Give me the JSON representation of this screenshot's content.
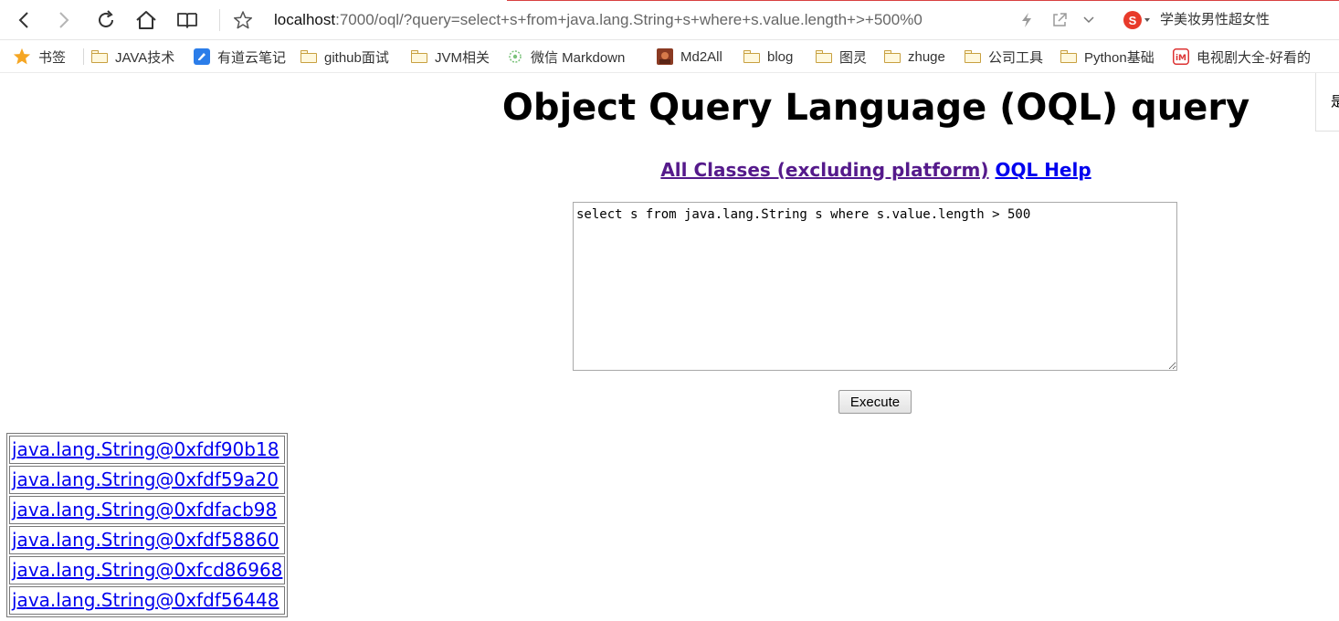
{
  "browser": {
    "url_host": "localhost",
    "url_rest": ":7000/oql/?query=select+s+from+java.lang.String+s+where+s.value.length+>+500%0",
    "search_hint": "学美妆男性超女性",
    "search_engine_glyph": "S",
    "side_tab_text": "是",
    "icons": [
      "back-icon",
      "forward-icon",
      "reload-icon",
      "home-icon",
      "reader-icon",
      "star-icon",
      "lightning-icon",
      "share-icon",
      "chevron-down-icon"
    ]
  },
  "bookmarks": [
    {
      "label": "书签",
      "icon": "star"
    },
    {
      "label": "JAVA技术",
      "icon": "folder"
    },
    {
      "label": "有道云笔记",
      "icon": "youdao"
    },
    {
      "label": "github面试",
      "icon": "folder"
    },
    {
      "label": "JVM相关",
      "icon": "folder"
    },
    {
      "label": "微信 Markdown",
      "icon": "gear"
    },
    {
      "label": "Md2All",
      "icon": "image"
    },
    {
      "label": "blog",
      "icon": "folder"
    },
    {
      "label": "图灵",
      "icon": "folder"
    },
    {
      "label": "zhuge",
      "icon": "folder"
    },
    {
      "label": "公司工具",
      "icon": "folder"
    },
    {
      "label": "Python基础",
      "icon": "folder"
    },
    {
      "label": "电视剧大全-好看的",
      "icon": "tv"
    }
  ],
  "page": {
    "title": "Object Query Language (OQL) query",
    "links": [
      {
        "label": "All Classes (excluding platform)",
        "visited": true
      },
      {
        "label": "OQL Help",
        "visited": false
      }
    ],
    "query_text": "select s from java.lang.String s where s.value.length > 500",
    "execute_label": "Execute",
    "results": [
      "java.lang.String@0xfdf90b18",
      "java.lang.String@0xfdf59a20",
      "java.lang.String@0xfdfacb98",
      "java.lang.String@0xfdf58860",
      "java.lang.String@0xfcd86968",
      "java.lang.String@0xfdf56448"
    ]
  },
  "colors": {
    "link": "#0000ee",
    "visited_link": "#551a8b",
    "bookmark_star": "#f5a623",
    "sogou_red": "#e83a2a"
  }
}
